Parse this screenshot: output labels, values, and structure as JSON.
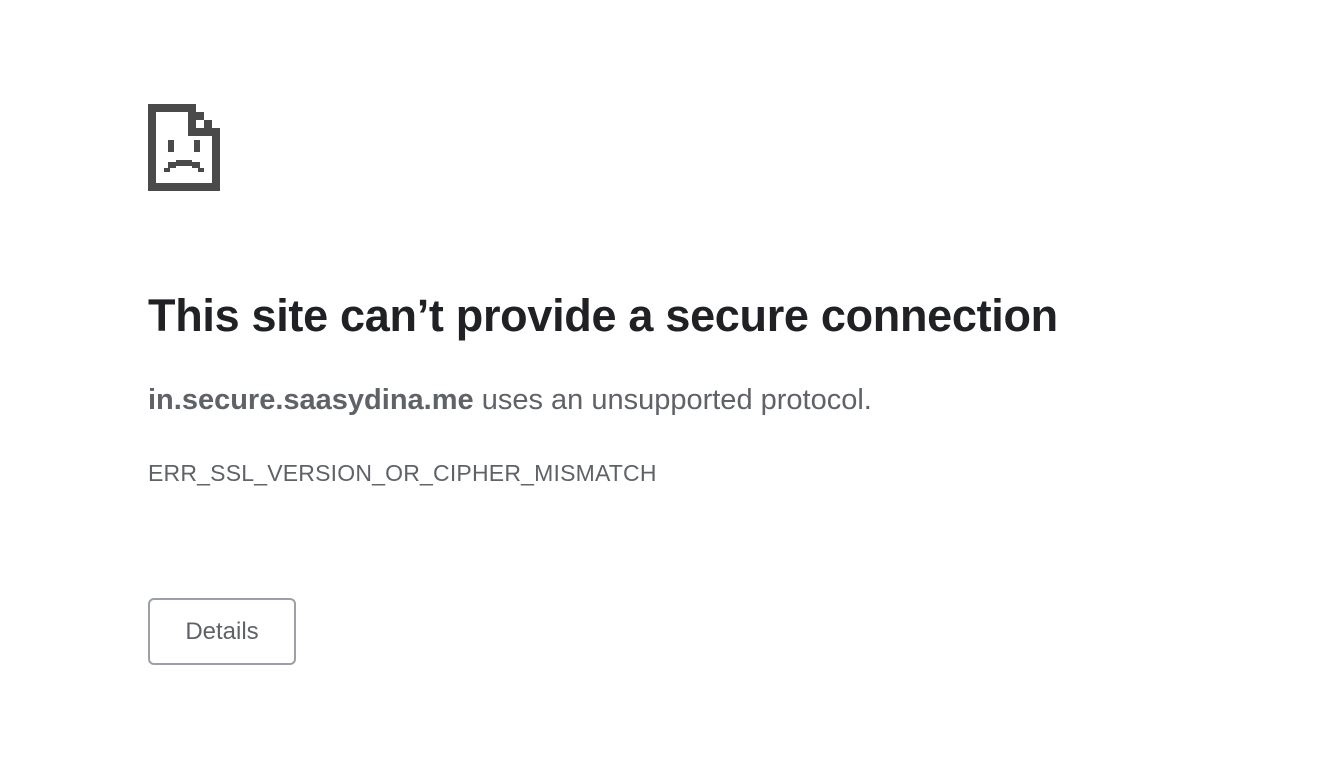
{
  "error_page": {
    "icon": "sad-page-icon",
    "title": "This site can’t provide a secure connection",
    "host": "in.secure.saasydina.me",
    "message_suffix": " uses an unsupported protocol.",
    "error_code": "ERR_SSL_VERSION_OR_CIPHER_MISMATCH",
    "details_button_label": "Details"
  },
  "colors": {
    "icon": "#4a4a4a",
    "title": "#202124",
    "body_text": "#5f6368",
    "button_border": "#9aa0a6",
    "background": "#ffffff"
  }
}
